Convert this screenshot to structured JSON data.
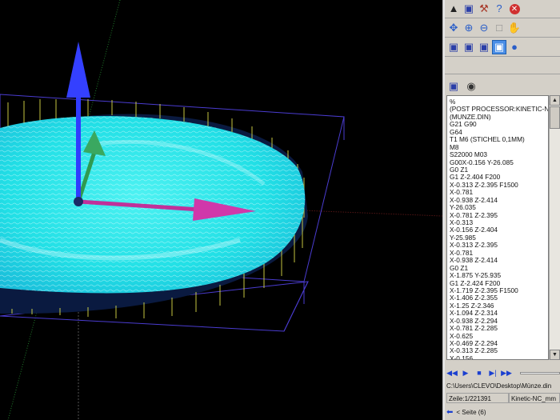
{
  "toolbar_row1": {
    "icons": [
      "open-file-icon",
      "save-icon",
      "hammer-icon",
      "help-icon",
      "close-icon"
    ]
  },
  "toolbar_row2": {
    "icons": [
      "move-icon",
      "zoom-in-icon",
      "zoom-out-icon",
      "zoom-box-icon",
      "pan-hand-icon"
    ]
  },
  "toolbar_row3": {
    "icons": [
      "cube-front-icon",
      "cube-side-icon",
      "cube-top-icon",
      "cube-iso-icon",
      "sphere-icon"
    ]
  },
  "code_toolbar": {
    "icons": [
      "save-disk-icon",
      "find-binoculars-icon"
    ]
  },
  "code_lines": [
    "%",
    "(POST PROCESSOR:KINETIC-NC_MM",
    "(MUNZE.DIN)",
    "G21 G90",
    "G64",
    "T1 M6 (STICHEL 0,1MM)",
    "M8",
    "S22000 M03",
    "G00X-0.156 Y-26.085",
    "G0 Z1",
    "G1 Z-2.404 F200",
    "X-0.313 Z-2.395 F1500",
    "X-0.781",
    "X-0.938 Z-2.414",
    "Y-26.035",
    "X-0.781 Z-2.395",
    "X-0.313",
    "X-0.156 Z-2.404",
    "Y-25.985",
    "X-0.313 Z-2.395",
    "X-0.781",
    "X-0.938 Z-2.414",
    "G0 Z1",
    "X-1.875 Y-25.935",
    "G1 Z-2.424 F200",
    "X-1.719 Z-2.395 F1500",
    "X-1.406 Z-2.355",
    "X-1.25 Z-2.346",
    "X-1.094 Z-2.314",
    "X-0.938 Z-2.294",
    "X-0.781 Z-2.285",
    "X-0.625",
    "X-0.469 Z-2.294",
    "X-0.313 Z-2.285",
    "X-0.156"
  ],
  "playback": {
    "icons": [
      "rewind-icon",
      "play-icon",
      "stop-icon",
      "step-forward-icon",
      "fast-forward-icon"
    ]
  },
  "status": {
    "file_path": "C:\\Users\\CLEVO\\Desktop\\Münze.din",
    "line_info": "Zeile:1/221391",
    "postprocessor": "Kinetic-NC_mm"
  },
  "page_nav": {
    "label": "< Seite (6)"
  },
  "colors": {
    "coin_fill": "#22e6e6",
    "coin_edge": "#e6e84a",
    "axis_z": "#2f3bff",
    "axis_x": "#c0309a",
    "axis_y": "#2f9a50",
    "box_outline": "#4a3cd0",
    "panel_bg": "#d4d0c8"
  }
}
